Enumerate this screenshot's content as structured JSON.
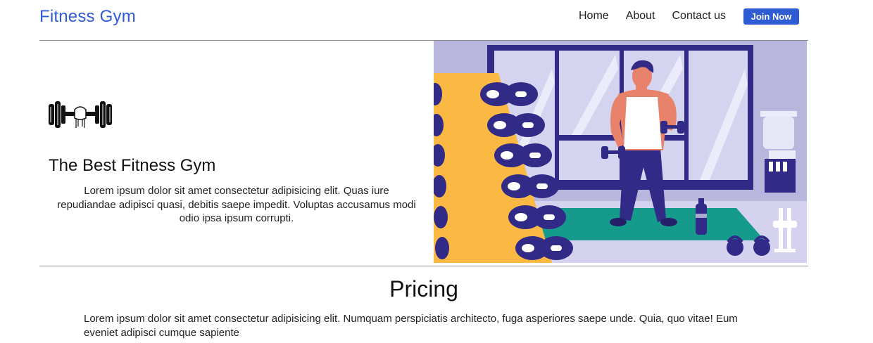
{
  "nav": {
    "brand": "Fitness Gym",
    "links": [
      "Home",
      "About",
      "Contact us"
    ],
    "cta": "Join Now"
  },
  "hero": {
    "title": "The Best Fitness Gym",
    "text": "Lorem ipsum dolor sit amet consectetur adipisicing elit. Quas iure repudiandae adipisci quasi, debitis saepe impedit. Voluptas accusamus modi odio ipsa ipsum corrupti."
  },
  "pricing": {
    "title": "Pricing",
    "text": "Lorem ipsum dolor sit amet consectetur adipisicing elit. Numquam perspiciatis architecto, fuga asperiores saepe unde. Quia, quo vitae! Eum eveniet adipisci cumque sapiente"
  },
  "icons": {
    "hero_icon": "dumbbell-icon",
    "hero_image": "gym-illustration"
  },
  "colors": {
    "brand": "#2f5bd3",
    "wall": "#b9b6de",
    "rack": "#fbb843",
    "mat": "#159a8c",
    "frame": "#312a86"
  }
}
